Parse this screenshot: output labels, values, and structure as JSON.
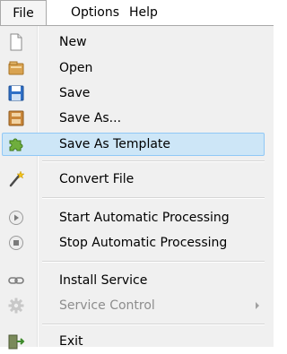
{
  "menubar": {
    "items": [
      {
        "label": "File"
      },
      {
        "label": "Options"
      },
      {
        "label": "Help"
      }
    ]
  },
  "menu": {
    "items": [
      {
        "label": "New",
        "icon": "new-file-icon"
      },
      {
        "label": "Open",
        "icon": "open-folder-icon"
      },
      {
        "label": "Save",
        "icon": "save-disk-icon"
      },
      {
        "label": "Save As...",
        "icon": "save-as-icon"
      },
      {
        "label": "Save As Template",
        "icon": "puzzle-piece-icon",
        "highlighted": true
      },
      {
        "label": "Convert File",
        "icon": "magic-wand-icon"
      },
      {
        "label": "Start Automatic Processing",
        "icon": "play-circle-icon"
      },
      {
        "label": "Stop Automatic Processing",
        "icon": "stop-circle-icon"
      },
      {
        "label": "Install Service",
        "icon": "chain-link-icon"
      },
      {
        "label": "Service Control",
        "icon": "gear-icon",
        "disabled": true,
        "submenu": true
      },
      {
        "label": "Exit",
        "icon": "exit-door-icon"
      }
    ]
  },
  "colors": {
    "highlight_fill": "#cde6f7",
    "highlight_border": "#90c8f6",
    "menu_background": "#f0f0f0",
    "disabled_text": "#8d8d8d"
  }
}
